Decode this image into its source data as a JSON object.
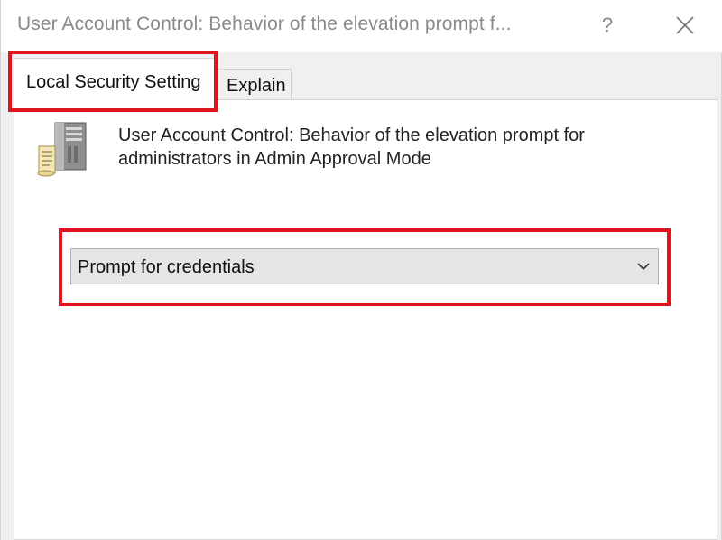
{
  "window": {
    "title": "User Account Control: Behavior of the elevation prompt f...",
    "help_label": "?",
    "close_icon": "close-icon"
  },
  "tabs": [
    {
      "label": "Local Security Setting",
      "selected": true
    },
    {
      "label": "Explain",
      "selected": false
    }
  ],
  "policy": {
    "icon": "server-icon",
    "description_line1": "User Account Control: Behavior of the elevation prompt for",
    "description_line2": "administrators in Admin Approval Mode",
    "selected_value": "Prompt for credentials",
    "dropdown_icon": "chevron-down-icon"
  },
  "annotations": {
    "highlight_color": "#e0141e"
  }
}
